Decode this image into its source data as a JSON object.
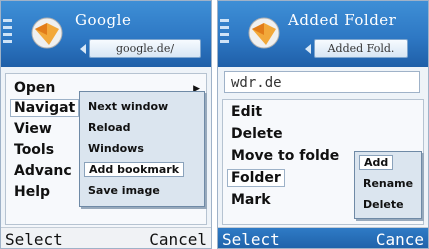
{
  "left_phone": {
    "title": "Google",
    "address": "google.de/",
    "menu": [
      {
        "label": "Open",
        "has_submenu": true
      },
      {
        "label": "Navigat",
        "selected": true
      },
      {
        "label": "View"
      },
      {
        "label": "Tools"
      },
      {
        "label": "Advanc"
      },
      {
        "label": "Help"
      }
    ],
    "submenu": [
      {
        "label": "Next window"
      },
      {
        "label": "Reload"
      },
      {
        "label": "Windows"
      },
      {
        "label": "Add bookmark",
        "selected": true
      },
      {
        "label": "Save image"
      }
    ],
    "softkeys": {
      "left": "Select",
      "right": "Cancel"
    }
  },
  "right_phone": {
    "title": "Added Folder",
    "address": "Added Fold.",
    "url": "wdr.de",
    "menu": [
      {
        "label": "Edit"
      },
      {
        "label": "Delete"
      },
      {
        "label": "Move to folde"
      },
      {
        "label": "Folder",
        "selected": true
      },
      {
        "label": "Mark"
      }
    ],
    "submenu": [
      {
        "label": "Add",
        "selected": true
      },
      {
        "label": "Rename"
      },
      {
        "label": "Delete"
      }
    ],
    "softkeys": {
      "left": "Select",
      "right": "Cance"
    }
  },
  "icons": {
    "app": "globe-icon",
    "status": "signal-bars-icon",
    "submenu_arrow": "arrow-right-icon"
  },
  "colors": {
    "header": "#2e78c4",
    "selection_bg": "#ffffff",
    "submenu_bg": "#dbe5ef"
  }
}
